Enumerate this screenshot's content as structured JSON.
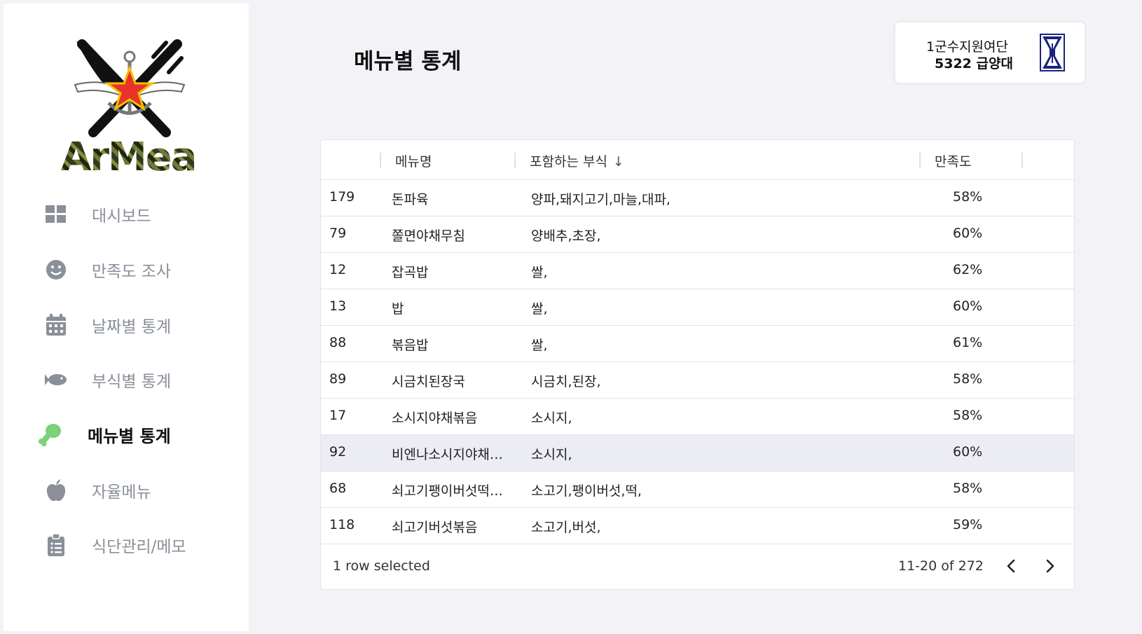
{
  "app": {
    "logo_text": "ArMeal"
  },
  "sidebar": {
    "items": [
      {
        "label": "대시보드",
        "icon": "grid-icon",
        "active": false
      },
      {
        "label": "만족도 조사",
        "icon": "smile-icon",
        "active": false
      },
      {
        "label": "날짜별 통계",
        "icon": "calendar-icon",
        "active": false
      },
      {
        "label": "부식별 통계",
        "icon": "fish-icon",
        "active": false
      },
      {
        "label": "메뉴별 통계",
        "icon": "drumstick-icon",
        "active": true
      },
      {
        "label": "자율메뉴",
        "icon": "apple-icon",
        "active": false
      },
      {
        "label": "식단관리/메모",
        "icon": "clipboard-icon",
        "active": false
      }
    ],
    "active_color": "#7ad27a",
    "inactive_color": "#8a8f99"
  },
  "header": {
    "title": "메뉴별 통계"
  },
  "unit": {
    "line1": "1군수지원여단",
    "line2": "5322 급양대"
  },
  "table": {
    "columns": [
      "메뉴명",
      "포함하는 부식",
      "만족도"
    ],
    "sort_icon": "arrow-down-icon",
    "rows": [
      {
        "id": "179",
        "name": "돈파육",
        "ingredients": "양파,돼지고기,마늘,대파,",
        "satisfaction": "58%"
      },
      {
        "id": "79",
        "name": "쫄면야채무침",
        "ingredients": "양배추,초장,",
        "satisfaction": "60%"
      },
      {
        "id": "12",
        "name": "잡곡밥",
        "ingredients": "쌀,",
        "satisfaction": "62%"
      },
      {
        "id": "13",
        "name": "밥",
        "ingredients": "쌀,",
        "satisfaction": "60%"
      },
      {
        "id": "88",
        "name": "볶음밥",
        "ingredients": "쌀,",
        "satisfaction": "61%"
      },
      {
        "id": "89",
        "name": "시금치된장국",
        "ingredients": "시금치,된장,",
        "satisfaction": "58%"
      },
      {
        "id": "17",
        "name": "소시지야채볶음",
        "ingredients": "소시지,",
        "satisfaction": "58%"
      },
      {
        "id": "92",
        "name": "비엔나소시지야채…",
        "ingredients": "소시지,",
        "satisfaction": "60%",
        "selected": true
      },
      {
        "id": "68",
        "name": "쇠고기팽이버섯떡…",
        "ingredients": "소고기,팽이버섯,떡,",
        "satisfaction": "58%"
      },
      {
        "id": "118",
        "name": "쇠고기버섯볶음",
        "ingredients": "소고기,버섯,",
        "satisfaction": "59%"
      }
    ],
    "selected_text": "1 row selected",
    "page_info": "11-20 of 272"
  }
}
